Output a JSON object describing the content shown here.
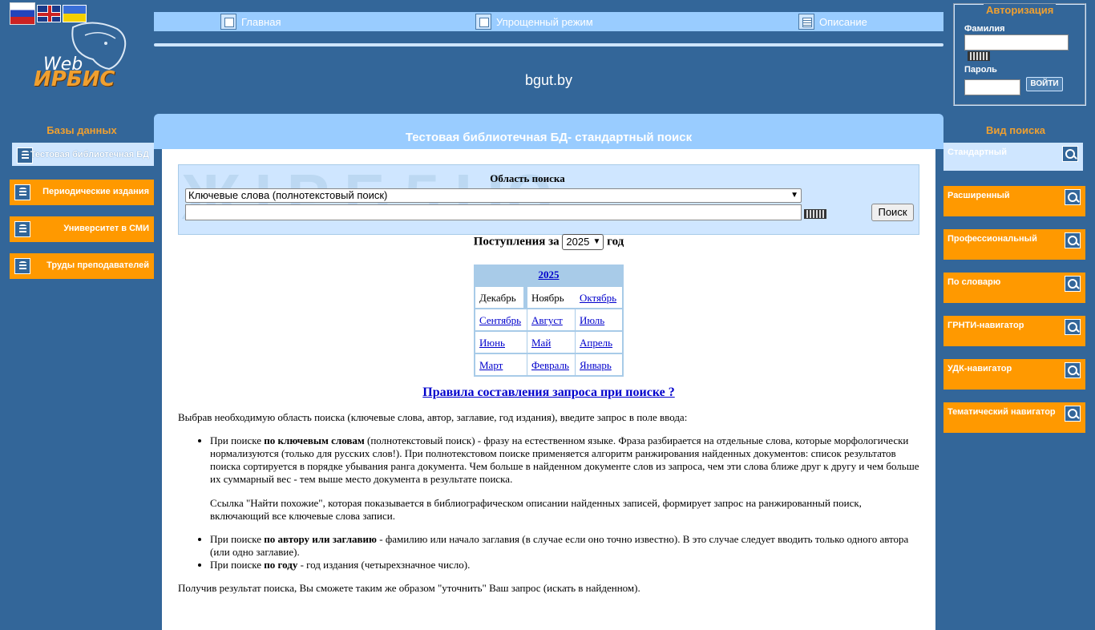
{
  "flags": [
    "ru",
    "en",
    "ua"
  ],
  "logo": {
    "web": "Web",
    "irbis": "ИРБИС"
  },
  "topnav": [
    {
      "label": "Главная",
      "icon": "window-icon"
    },
    {
      "label": "Упрощенный режим",
      "icon": "window-icon"
    },
    {
      "label": "Описание",
      "icon": "list-icon"
    }
  ],
  "site_name": "bgut.by",
  "auth": {
    "legend": "Авторизация",
    "surname_label": "Фамилия",
    "password_label": "Пароль",
    "login_button": "ВОЙТИ"
  },
  "databases": {
    "heading": "Базы данных",
    "items": [
      {
        "label": "Тестовая библиотечная БД",
        "active": true
      },
      {
        "label": "Периодические издания",
        "active": false
      },
      {
        "label": "Университет в СМИ",
        "active": false
      },
      {
        "label": "Труды преподавателей",
        "active": false
      }
    ]
  },
  "search_types": {
    "heading": "Вид поиска",
    "items": [
      {
        "label": "Стандартный",
        "active": true
      },
      {
        "label": "Расширенный",
        "active": false
      },
      {
        "label": "Профессиональный",
        "active": false
      },
      {
        "label": "По словарю",
        "active": false
      },
      {
        "label": "ГРНТИ-навигатор",
        "active": false
      },
      {
        "label": "УДК-навигатор",
        "active": false
      },
      {
        "label": "Тематический навигатор",
        "active": false
      }
    ]
  },
  "main": {
    "title": "Тестовая библиотечная БД- стандартный поиск",
    "search_area_label": "Область поиска",
    "search_area_value": "Ключевые слова (полнотекстовый поиск)",
    "query_value": "",
    "search_button": "Поиск",
    "arrivals_prefix": "Поступления за",
    "arrivals_year": "2025",
    "arrivals_suffix": "год",
    "calendar": {
      "year": "2025",
      "months": [
        {
          "label": "Декабрь",
          "link": false
        },
        {
          "label": "Ноябрь",
          "link": false
        },
        {
          "label": "Октябрь",
          "link": true
        },
        {
          "label": "Сентябрь",
          "link": true
        },
        {
          "label": "Август",
          "link": true
        },
        {
          "label": "Июль",
          "link": true
        },
        {
          "label": "Июнь",
          "link": true
        },
        {
          "label": "Май",
          "link": true
        },
        {
          "label": "Апрель",
          "link": true
        },
        {
          "label": "Март",
          "link": true
        },
        {
          "label": "Февраль",
          "link": true
        },
        {
          "label": "Январь",
          "link": true
        }
      ]
    },
    "rules_link": "Правила составления запроса при поиске ?",
    "intro": "Выбрав необходимую область поиска (ключевые слова, автор, заглавие, год издания), введите запрос в поле ввода:",
    "bullets": [
      {
        "pre": "При поиске ",
        "bold": "по ключевым словам",
        "post": " (полнотекстовый поиск) - фразу на естественном языке. Фраза разбирается на отдельные слова, которые морфологически нормализуются (только для русских слов!). При полнотекстовом поиске применяется алгоритм ранжирования найденных документов: список результатов поиска сортируется в порядке убывания ранга документа. Чем больше в найденном документе слов из запроса, чем эти слова ближе друг к другу и чем больше их суммарный вес - тем выше место документа в результате поиска.",
        "extra": "Ссылка \"Найти похожие\", которая показывается в библиографическом описании найденных записей, формирует запрос на ранжированный поиск, включающий все ключевые слова записи."
      },
      {
        "pre": "При поиске ",
        "bold": "по автору или заглавию",
        "post": " - фамилию или начало заглавия (в случае если оно точно известно). В это случае следует вводить только одного автора (или одно заглавие).",
        "extra": ""
      },
      {
        "pre": "При поиске ",
        "bold": "по году",
        "post": " - год издания (четырехзначное число).",
        "extra": ""
      }
    ],
    "outro": "Получив результат поиска, Вы сможете таким же образом \"уточнить\" Ваш запрос (искать в найденном)."
  }
}
